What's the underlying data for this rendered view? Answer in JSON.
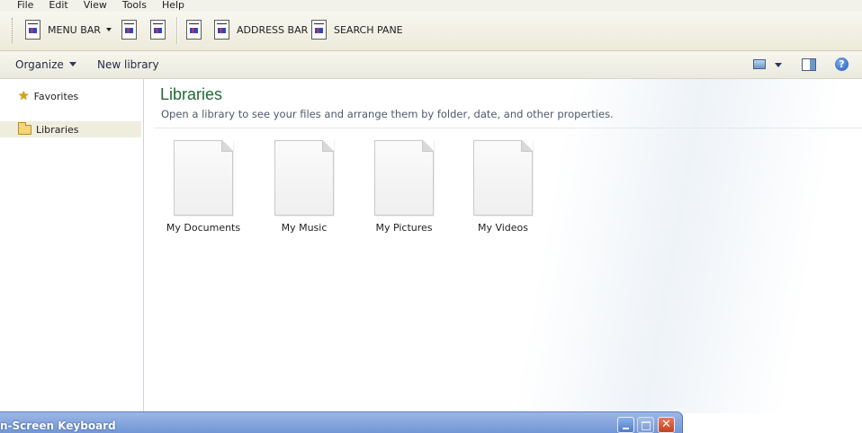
{
  "menu": [
    "File",
    "Edit",
    "View",
    "Tools",
    "Help"
  ],
  "toolbar": {
    "menu_bar_label": "MENU BAR",
    "address_bar_label": "ADDRESS BAR",
    "search_pane_label": "SEARCH PANE"
  },
  "commandbar": {
    "organize_label": "Organize",
    "new_library_label": "New library"
  },
  "nav": {
    "favorites_label": "Favorites",
    "libraries_label": "Libraries"
  },
  "main": {
    "title": "Libraries",
    "subtitle": "Open a library to see your files and arrange them by folder, date, and other properties.",
    "items": [
      {
        "label": "My Documents",
        "icon": "document-file-icon"
      },
      {
        "label": "My Music",
        "icon": "document-file-icon"
      },
      {
        "label": "My Pictures",
        "icon": "document-file-icon"
      },
      {
        "label": "My Videos",
        "icon": "document-file-icon"
      }
    ]
  },
  "osk": {
    "title": "n-Screen Keyboard",
    "close_glyph": "✕"
  },
  "icons": {
    "help_glyph": "?",
    "star_glyph": "★"
  },
  "colors": {
    "title_green": "#1e6b33",
    "osk_blue": "#7296d6"
  }
}
